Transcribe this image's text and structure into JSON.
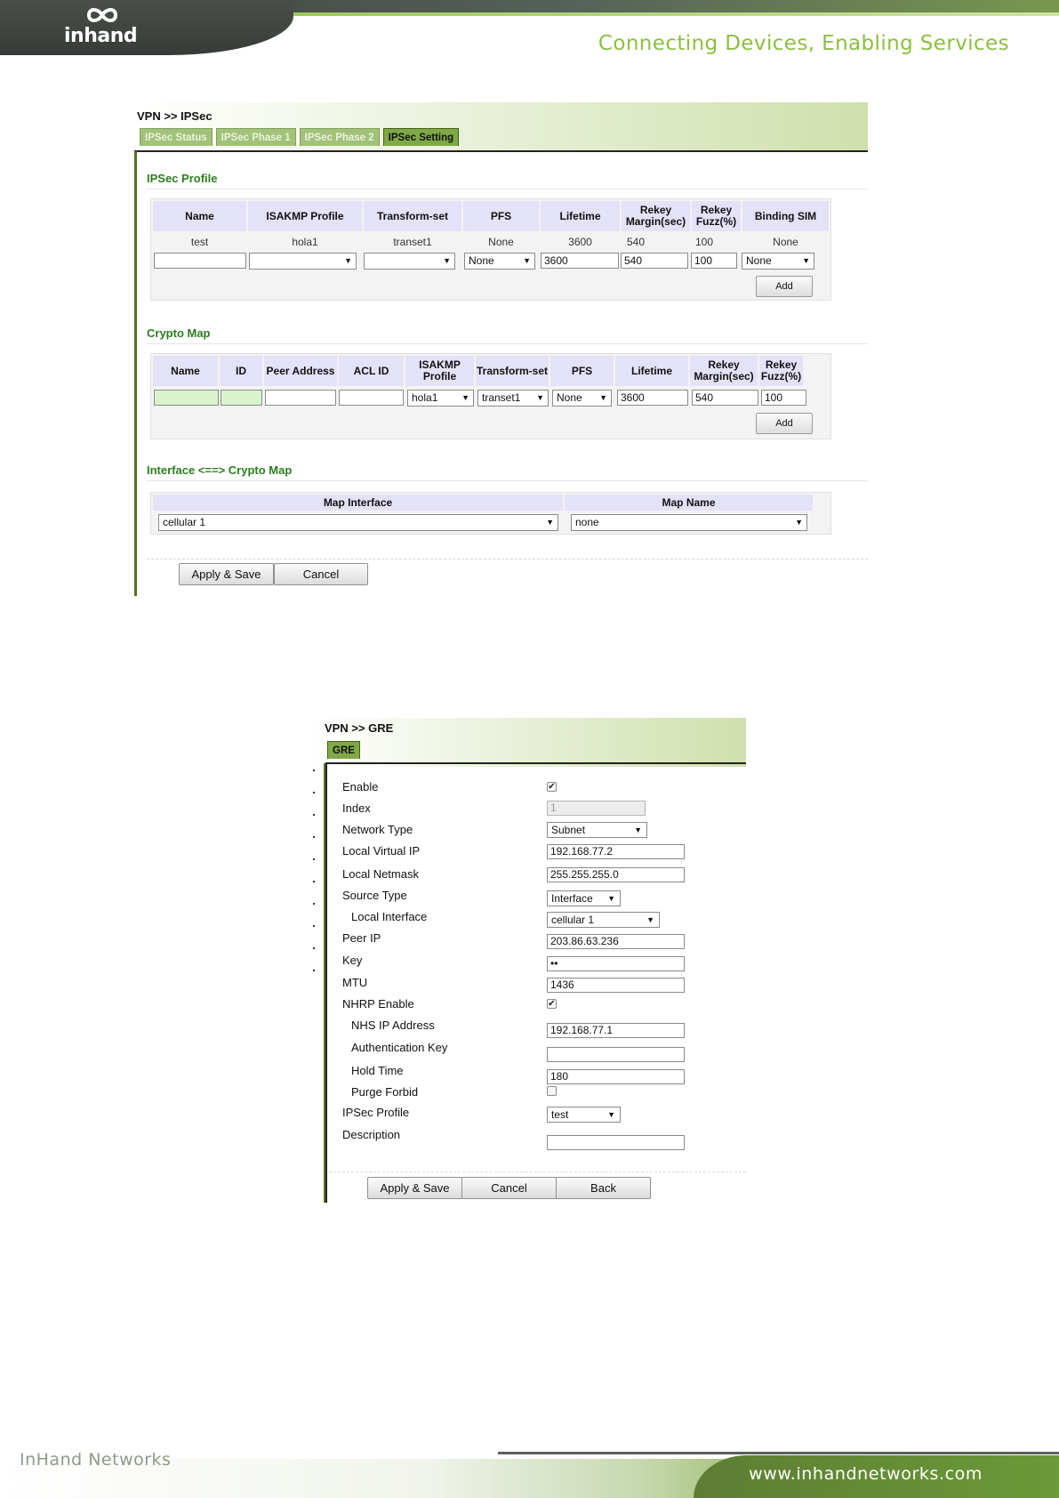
{
  "header": {
    "logo_text": "inhand",
    "tagline": "Connecting Devices, Enabling Services"
  },
  "footer": {
    "company": "InHand Networks",
    "website": "www.inhandnetworks.com"
  },
  "ipsec": {
    "breadcrumb": "VPN >> IPSec",
    "tabs": [
      {
        "label": "IPSec Status",
        "active": false
      },
      {
        "label": "IPSec Phase 1",
        "active": false
      },
      {
        "label": "IPSec Phase 2",
        "active": false
      },
      {
        "label": "IPSec Setting",
        "active": true
      }
    ],
    "profile": {
      "title": "IPSec Profile",
      "headers": [
        "Name",
        "ISAKMP Profile",
        "Transform-set",
        "PFS",
        "Lifetime",
        "Rekey Margin(sec)",
        "Rekey Fuzz(%)",
        "Binding SIM"
      ],
      "rows": [
        [
          "test",
          "hola1",
          "transet1",
          "None",
          "3600",
          "540",
          "100",
          "None"
        ]
      ],
      "new_row": {
        "name": "",
        "isakmp_profile": "",
        "transform_set": "",
        "pfs": "None",
        "lifetime": "3600",
        "rekey_margin": "540",
        "rekey_fuzz": "100",
        "binding_sim": "None"
      },
      "add_label": "Add"
    },
    "crypto_map": {
      "title": "Crypto Map",
      "headers": [
        "Name",
        "ID",
        "Peer Address",
        "ACL ID",
        "ISAKMP Profile",
        "Transform-set",
        "PFS",
        "Lifetime",
        "Rekey Margin(sec)",
        "Rekey Fuzz(%)"
      ],
      "new_row": {
        "name": "",
        "id": "",
        "peer_address": "",
        "acl_id": "",
        "isakmp_profile": "hola1",
        "transform_set": "transet1",
        "pfs": "None",
        "lifetime": "3600",
        "rekey_margin": "540",
        "rekey_fuzz": "100"
      },
      "add_label": "Add"
    },
    "interface_map": {
      "title": "Interface <==> Crypto Map",
      "headers": [
        "Map Interface",
        "Map Name"
      ],
      "map_interface": "cellular 1",
      "map_name": "none"
    },
    "buttons": {
      "apply": "Apply & Save",
      "cancel": "Cancel"
    }
  },
  "gre": {
    "breadcrumb": "VPN >> GRE",
    "tab": "GRE",
    "fields": {
      "enable": {
        "label": "Enable",
        "checked": true
      },
      "index": {
        "label": "Index",
        "value": "1"
      },
      "network_type": {
        "label": "Network Type",
        "value": "Subnet"
      },
      "local_virtual_ip": {
        "label": "Local Virtual IP",
        "value": "192.168.77.2"
      },
      "local_netmask": {
        "label": "Local Netmask",
        "value": "255.255.255.0"
      },
      "source_type": {
        "label": "Source Type",
        "value": "Interface"
      },
      "local_interface": {
        "label": "Local Interface",
        "value": "cellular 1"
      },
      "peer_ip": {
        "label": "Peer IP",
        "value": "203.86.63.236"
      },
      "key": {
        "label": "Key",
        "value": "••"
      },
      "mtu": {
        "label": "MTU",
        "value": "1436"
      },
      "nhrp_enable": {
        "label": "NHRP Enable",
        "checked": true
      },
      "nhs_ip": {
        "label": "NHS IP Address",
        "value": "192.168.77.1"
      },
      "auth_key": {
        "label": "Authentication Key",
        "value": ""
      },
      "hold_time": {
        "label": "Hold Time",
        "value": "180"
      },
      "purge_forbid": {
        "label": "Purge Forbid",
        "checked": false
      },
      "ipsec_profile": {
        "label": "IPSec Profile",
        "value": "test"
      },
      "description": {
        "label": "Description",
        "value": ""
      }
    },
    "buttons": {
      "apply": "Apply & Save",
      "cancel": "Cancel",
      "back": "Back"
    }
  }
}
